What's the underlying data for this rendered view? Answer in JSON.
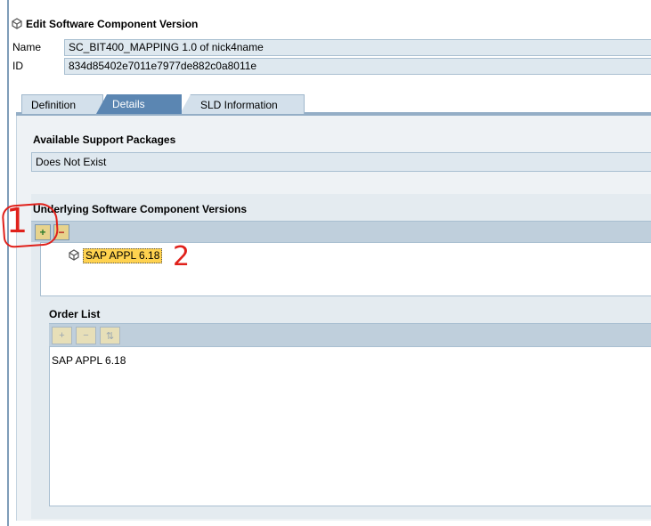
{
  "header": {
    "title": "Edit Software Component Version",
    "icon": "component-icon"
  },
  "fields": {
    "name_label": "Name",
    "name_value": "SC_BIT400_MAPPING 1.0 of nick4name",
    "id_label": "ID",
    "id_value": "834d85402e7011e7977de882c0a8011e"
  },
  "tabs": [
    {
      "label": "Definition",
      "active": false
    },
    {
      "label": "Details",
      "active": true
    },
    {
      "label": "SLD Information",
      "active": false
    }
  ],
  "support_packages": {
    "title": "Available Support Packages",
    "value": "Does Not Exist"
  },
  "underlying": {
    "title": "Underlying Software Component Versions",
    "toolbar": {
      "add": "+",
      "remove": "−"
    },
    "items": [
      {
        "label": "SAP APPL 6.18",
        "icon": "component-icon",
        "selected": true
      }
    ]
  },
  "order_list": {
    "title": "Order List",
    "toolbar": {
      "b1": "+",
      "b2": "−",
      "b3": "⇅"
    },
    "items": [
      "SAP APPL 6.18"
    ]
  },
  "annotations": {
    "one": "1",
    "two": "2",
    "color": "#e0211b"
  },
  "colors": {
    "accent": "#5b86b2",
    "field_bg": "#dee8ef",
    "highlight": "#ffd24f"
  }
}
